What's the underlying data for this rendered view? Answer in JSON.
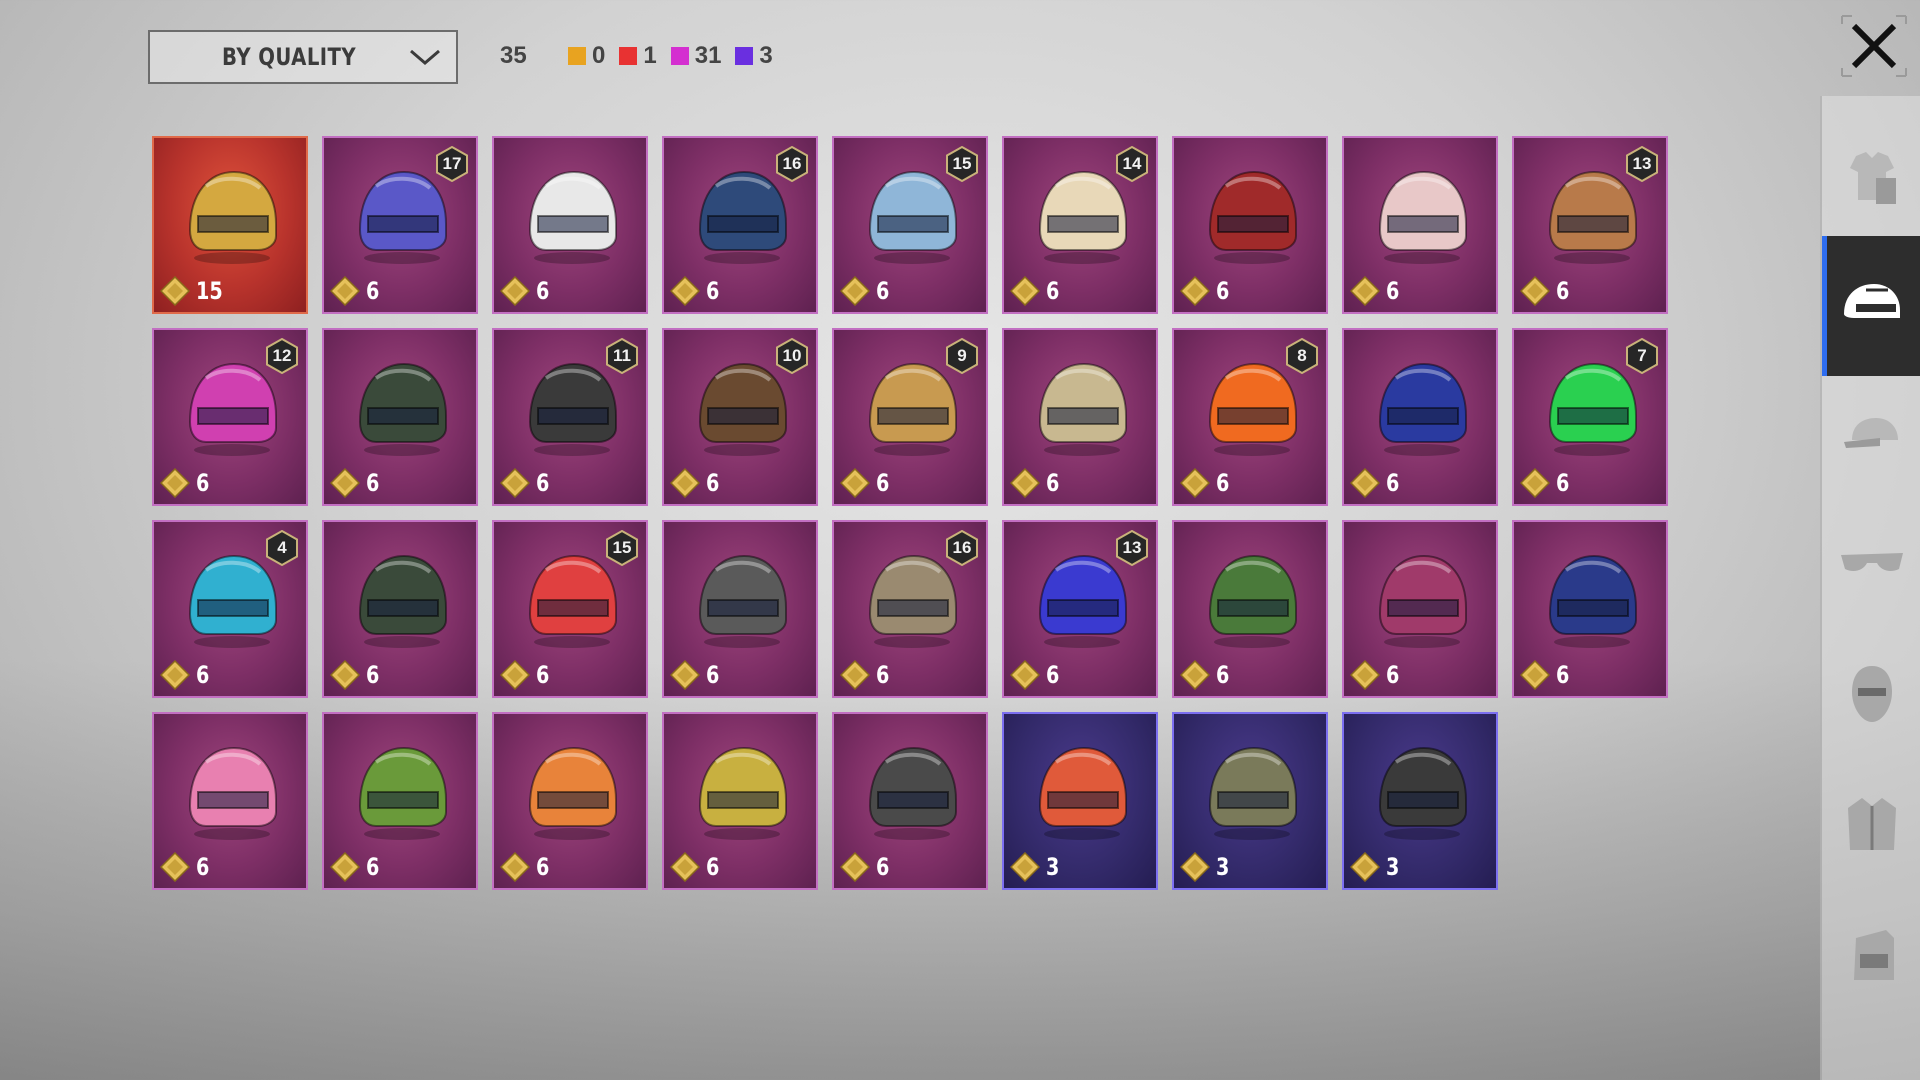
{
  "filter": {
    "sort_label": "BY QUALITY",
    "total_count": "35",
    "legend": [
      {
        "color": "#e8a320",
        "count": "0"
      },
      {
        "color": "#e83232",
        "count": "1"
      },
      {
        "color": "#d42fd0",
        "count": "31"
      },
      {
        "color": "#6a2fe0",
        "count": "3"
      }
    ]
  },
  "colors": {
    "tier_gold": "#b8332c",
    "tier_purple": "#7e2f66",
    "tier_blue": "#332a6a",
    "active_tab_accent": "#2e6df0"
  },
  "sidebar": {
    "items": [
      {
        "icon": "outfit-icon",
        "active": false
      },
      {
        "icon": "helmet-icon",
        "active": true
      },
      {
        "icon": "cap-icon",
        "active": false
      },
      {
        "icon": "glasses-icon",
        "active": false
      },
      {
        "icon": "mask-icon",
        "active": false
      },
      {
        "icon": "jacket-icon",
        "active": false
      },
      {
        "icon": "backpack-icon",
        "active": false
      }
    ]
  },
  "items": [
    {
      "tier": "gold",
      "level": "",
      "count": "15",
      "hue": "#d4a840"
    },
    {
      "tier": "purple",
      "level": "17",
      "count": "6",
      "hue": "#5a58c8"
    },
    {
      "tier": "purple",
      "level": "",
      "count": "6",
      "hue": "#e8e8e8"
    },
    {
      "tier": "purple",
      "level": "16",
      "count": "6",
      "hue": "#2e4a7a"
    },
    {
      "tier": "purple",
      "level": "15",
      "count": "6",
      "hue": "#8fb6d8"
    },
    {
      "tier": "purple",
      "level": "14",
      "count": "6",
      "hue": "#e8d8b8"
    },
    {
      "tier": "purple",
      "level": "",
      "count": "6",
      "hue": "#a02a2a"
    },
    {
      "tier": "purple",
      "level": "",
      "count": "6",
      "hue": "#e8c8c8"
    },
    {
      "tier": "purple",
      "level": "13",
      "count": "6",
      "hue": "#b87a4a"
    },
    {
      "tier": "purple",
      "level": "12",
      "count": "6",
      "hue": "#d040b0"
    },
    {
      "tier": "purple",
      "level": "",
      "count": "6",
      "hue": "#3a4a3a"
    },
    {
      "tier": "purple",
      "level": "11",
      "count": "6",
      "hue": "#3a3a3a"
    },
    {
      "tier": "purple",
      "level": "10",
      "count": "6",
      "hue": "#6a4a30"
    },
    {
      "tier": "purple",
      "level": "9",
      "count": "6",
      "hue": "#c89a50"
    },
    {
      "tier": "purple",
      "level": "",
      "count": "6",
      "hue": "#c8b890"
    },
    {
      "tier": "purple",
      "level": "8",
      "count": "6",
      "hue": "#f06a20"
    },
    {
      "tier": "purple",
      "level": "",
      "count": "6",
      "hue": "#2a3aa0"
    },
    {
      "tier": "purple",
      "level": "7",
      "count": "6",
      "hue": "#2ad050"
    },
    {
      "tier": "purple",
      "level": "4",
      "count": "6",
      "hue": "#30b0d0"
    },
    {
      "tier": "purple",
      "level": "",
      "count": "6",
      "hue": "#3a4a3a"
    },
    {
      "tier": "purple",
      "level": "15",
      "count": "6",
      "hue": "#e04040"
    },
    {
      "tier": "purple",
      "level": "",
      "count": "6",
      "hue": "#5a5a5a"
    },
    {
      "tier": "purple",
      "level": "16",
      "count": "6",
      "hue": "#9a8a70"
    },
    {
      "tier": "purple",
      "level": "13",
      "count": "6",
      "hue": "#3a3ad0"
    },
    {
      "tier": "purple",
      "level": "",
      "count": "6",
      "hue": "#4a7a3a"
    },
    {
      "tier": "purple",
      "level": "",
      "count": "6",
      "hue": "#a03a6a"
    },
    {
      "tier": "purple",
      "level": "",
      "count": "6",
      "hue": "#2a3a8a"
    },
    {
      "tier": "purple",
      "level": "",
      "count": "6",
      "hue": "#e880b0"
    },
    {
      "tier": "purple",
      "level": "",
      "count": "6",
      "hue": "#6a9a3a"
    },
    {
      "tier": "purple",
      "level": "",
      "count": "6",
      "hue": "#e8833a"
    },
    {
      "tier": "purple",
      "level": "",
      "count": "6",
      "hue": "#c8b040"
    },
    {
      "tier": "purple",
      "level": "",
      "count": "6",
      "hue": "#4a4a4a"
    },
    {
      "tier": "blue",
      "level": "",
      "count": "3",
      "hue": "#e05a3a"
    },
    {
      "tier": "blue",
      "level": "",
      "count": "3",
      "hue": "#7a7a5a"
    },
    {
      "tier": "blue",
      "level": "",
      "count": "3",
      "hue": "#3a3a3a"
    }
  ]
}
